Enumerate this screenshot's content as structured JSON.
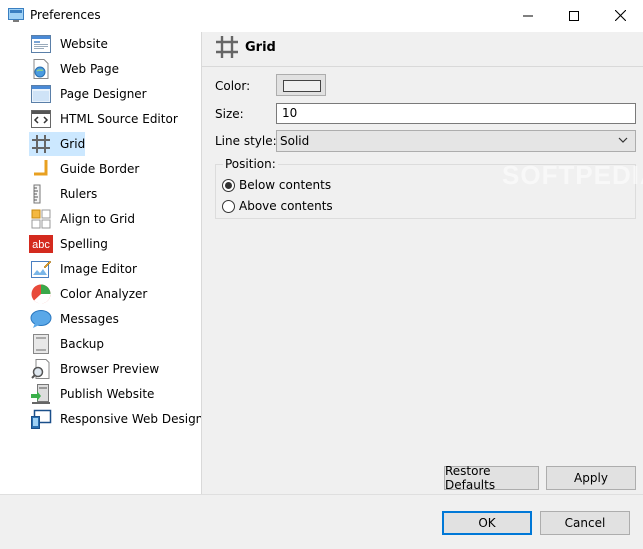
{
  "window": {
    "title": "Preferences",
    "controls": [
      "minimize",
      "maximize",
      "close"
    ]
  },
  "sidebar": {
    "selected": "Grid",
    "items": [
      {
        "label": "Website",
        "icon": "website-icon"
      },
      {
        "label": "Web Page",
        "icon": "web-page-icon"
      },
      {
        "label": "Page Designer",
        "icon": "page-designer-icon"
      },
      {
        "label": "HTML Source Editor",
        "icon": "html-source-icon"
      },
      {
        "label": "Grid",
        "icon": "grid-icon"
      },
      {
        "label": "Guide Border",
        "icon": "guide-border-icon"
      },
      {
        "label": "Rulers",
        "icon": "rulers-icon"
      },
      {
        "label": "Align to Grid",
        "icon": "align-to-grid-icon"
      },
      {
        "label": "Spelling",
        "icon": "spelling-icon",
        "icon_text": "abc"
      },
      {
        "label": "Image Editor",
        "icon": "image-editor-icon"
      },
      {
        "label": "Color Analyzer",
        "icon": "color-analyzer-icon"
      },
      {
        "label": "Messages",
        "icon": "messages-icon"
      },
      {
        "label": "Backup",
        "icon": "backup-icon"
      },
      {
        "label": "Browser Preview",
        "icon": "browser-preview-icon"
      },
      {
        "label": "Publish Website",
        "icon": "publish-website-icon"
      },
      {
        "label": "Responsive Web Design",
        "icon": "responsive-design-icon"
      }
    ]
  },
  "panel": {
    "title": "Grid",
    "color_label": "Color:",
    "color_value": "#f0f0f0",
    "size_label": "Size:",
    "size_value": "10",
    "line_style_label": "Line style:",
    "line_style_value": "Solid",
    "position_label": "Position:",
    "position_options": [
      "Below contents",
      "Above contents"
    ],
    "position_selected": "Below contents",
    "watermark": "SOFTPEDIA"
  },
  "buttons": {
    "restore": "Restore Defaults",
    "apply": "Apply",
    "ok": "OK",
    "cancel": "Cancel"
  },
  "colors": {
    "selection": "#cce8ff",
    "panel_bg": "#f0f0f0",
    "default_button_border": "#0078d7"
  }
}
